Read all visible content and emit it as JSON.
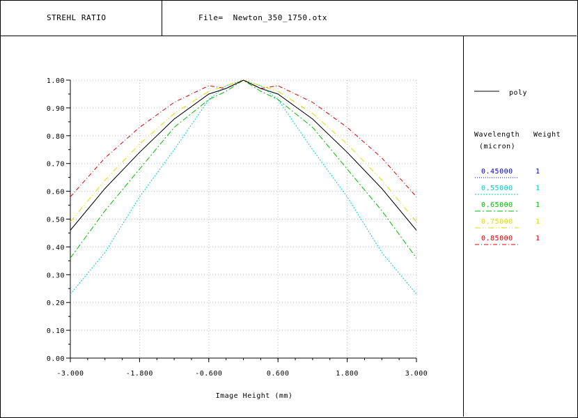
{
  "header": {
    "title": "STREHL RATIO",
    "file_label": "File=",
    "file_name": "Newton_350_1750.otx"
  },
  "legend": {
    "poly_label": "poly",
    "col_wavelength": "Wavelength",
    "col_weight": "Weight",
    "unit": "(micron)",
    "entries": [
      {
        "wavelength": "0.45000",
        "weight": "1",
        "color": "#0000cc",
        "dash": "1,2"
      },
      {
        "wavelength": "0.55000",
        "weight": "1",
        "color": "#00cccc",
        "dash": "2,2"
      },
      {
        "wavelength": "0.65000",
        "weight": "1",
        "color": "#00bb00",
        "dash": "8,3,2,3"
      },
      {
        "wavelength": "0.75000",
        "weight": "1",
        "color": "#dddd00",
        "dash": "8,3,1,3,1,3"
      },
      {
        "wavelength": "0.85000",
        "weight": "1",
        "color": "#dd0000",
        "dash": "6,3,1,3"
      }
    ]
  },
  "chart_data": {
    "type": "line",
    "title": "",
    "xlabel": "Image Height (mm)",
    "ylabel": "",
    "xlim": [
      -3.0,
      3.0
    ],
    "ylim": [
      0.0,
      1.0
    ],
    "grid": true,
    "x_ticks": [
      "-3.000",
      "-1.800",
      "-0.600",
      "0.600",
      "1.800",
      "3.000"
    ],
    "x_tick_values": [
      -3.0,
      -1.8,
      -0.6,
      0.6,
      1.8,
      3.0
    ],
    "y_ticks": [
      "0.00",
      "0.10",
      "0.20",
      "0.30",
      "0.40",
      "0.50",
      "0.60",
      "0.70",
      "0.80",
      "0.90",
      "1.00"
    ],
    "y_tick_values": [
      0.0,
      0.1,
      0.2,
      0.3,
      0.4,
      0.5,
      0.6,
      0.7,
      0.8,
      0.9,
      1.0
    ],
    "x": [
      -3.0,
      -2.4,
      -1.8,
      -1.2,
      -0.6,
      -0.3,
      0.0,
      0.3,
      0.6,
      1.2,
      1.8,
      2.4,
      3.0
    ],
    "series": [
      {
        "name": "poly",
        "color": "#000000",
        "dash": "",
        "values": [
          0.46,
          0.61,
          0.74,
          0.86,
          0.95,
          0.97,
          1.0,
          0.97,
          0.95,
          0.86,
          0.74,
          0.61,
          0.46
        ]
      },
      {
        "name": "0.45000",
        "color": "#0000cc",
        "dash": "1,2",
        "values": [
          0.46,
          0.61,
          0.74,
          0.86,
          0.95,
          0.97,
          1.0,
          0.97,
          0.95,
          0.86,
          0.74,
          0.61,
          0.46
        ]
      },
      {
        "name": "0.55000",
        "color": "#00cccc",
        "dash": "2,2",
        "values": [
          0.23,
          0.38,
          0.58,
          0.75,
          0.93,
          0.98,
          1.0,
          0.98,
          0.93,
          0.75,
          0.58,
          0.38,
          0.23
        ]
      },
      {
        "name": "0.65000",
        "color": "#00bb00",
        "dash": "8,3,2,3",
        "values": [
          0.36,
          0.53,
          0.68,
          0.83,
          0.93,
          0.96,
          1.0,
          0.96,
          0.93,
          0.83,
          0.68,
          0.53,
          0.36
        ]
      },
      {
        "name": "0.75000",
        "color": "#dddd00",
        "dash": "8,3,1,3,1,3",
        "values": [
          0.49,
          0.64,
          0.77,
          0.88,
          0.96,
          0.98,
          1.0,
          0.98,
          0.96,
          0.88,
          0.77,
          0.64,
          0.49
        ]
      },
      {
        "name": "0.85000",
        "color": "#dd0000",
        "dash": "6,3,1,3",
        "values": [
          0.58,
          0.72,
          0.83,
          0.92,
          0.98,
          0.97,
          1.0,
          0.97,
          0.98,
          0.92,
          0.83,
          0.72,
          0.58
        ]
      }
    ]
  }
}
